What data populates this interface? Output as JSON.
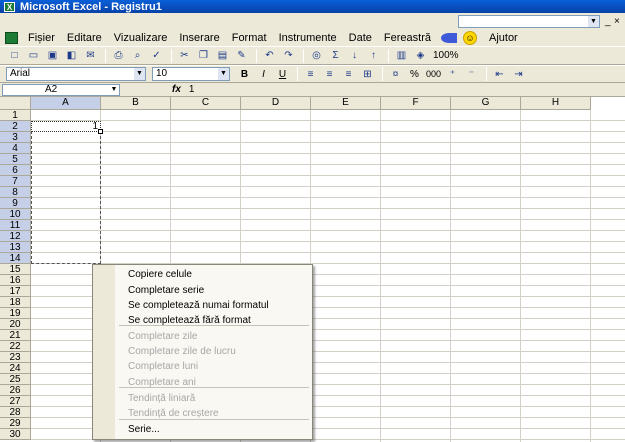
{
  "app": {
    "title": "Microsoft Excel - Registru1",
    "icon": "excel-icon"
  },
  "window_controls": [
    "_",
    "□",
    "×"
  ],
  "menubar": {
    "items": [
      "Fișier",
      "Editare",
      "Vizualizare",
      "Inserare",
      "Format",
      "Instrumente",
      "Date",
      "Fereastră",
      "Ajutor"
    ]
  },
  "toolbar_standard": {
    "zoom": "100%",
    "icons": [
      "new-icon",
      "open-icon",
      "save-icon",
      "permission-icon",
      "email-icon",
      "print-icon",
      "print-preview-icon",
      "spelling-icon",
      "cut-icon",
      "copy-icon",
      "paste-icon",
      "format-painter-icon",
      "undo-icon",
      "redo-icon",
      "hyperlink-icon",
      "autosum-icon",
      "sort-ascending-icon",
      "sort-descending-icon",
      "chart-wizard-icon",
      "drawing-icon"
    ]
  },
  "toolbar_formatting": {
    "font": "Arial",
    "size": "10",
    "bold": "B",
    "italic": "I",
    "underline": "U",
    "percent": "%",
    "thousands": "000"
  },
  "formula_bar": {
    "name_box": "A2",
    "fx": "fx",
    "value": "1"
  },
  "sheet": {
    "columns": [
      "A",
      "B",
      "C",
      "D",
      "E",
      "F",
      "G",
      "H"
    ],
    "rows": [
      "1",
      "2",
      "3",
      "4",
      "5",
      "6",
      "7",
      "8",
      "9",
      "10",
      "11",
      "12",
      "13",
      "14",
      "15",
      "16",
      "17",
      "18",
      "19",
      "20",
      "21",
      "22",
      "23",
      "24",
      "25",
      "26",
      "27",
      "28",
      "29",
      "30"
    ],
    "selected_column": "A",
    "cell_a2_value": "1"
  },
  "context_menu": {
    "items": [
      {
        "label": "Copiere celule",
        "enabled": true
      },
      {
        "label": "Completare serie",
        "enabled": true
      },
      {
        "label": "Se completează numai formatul",
        "enabled": true
      },
      {
        "label": "Se completează fără format",
        "enabled": true
      },
      {
        "label": "Completare zile",
        "enabled": false
      },
      {
        "label": "Completare zile de lucru",
        "enabled": false
      },
      {
        "label": "Completare luni",
        "enabled": false
      },
      {
        "label": "Completare ani",
        "enabled": false
      },
      {
        "label": "Tendință liniară",
        "enabled": false
      },
      {
        "label": "Tendință de creștere",
        "enabled": false
      },
      {
        "label": "Serie...",
        "enabled": true
      }
    ]
  },
  "colors": {
    "title_bar": "#0a5fd8",
    "header_selected": "#c5d0e8",
    "chrome": "#ece9d8"
  }
}
